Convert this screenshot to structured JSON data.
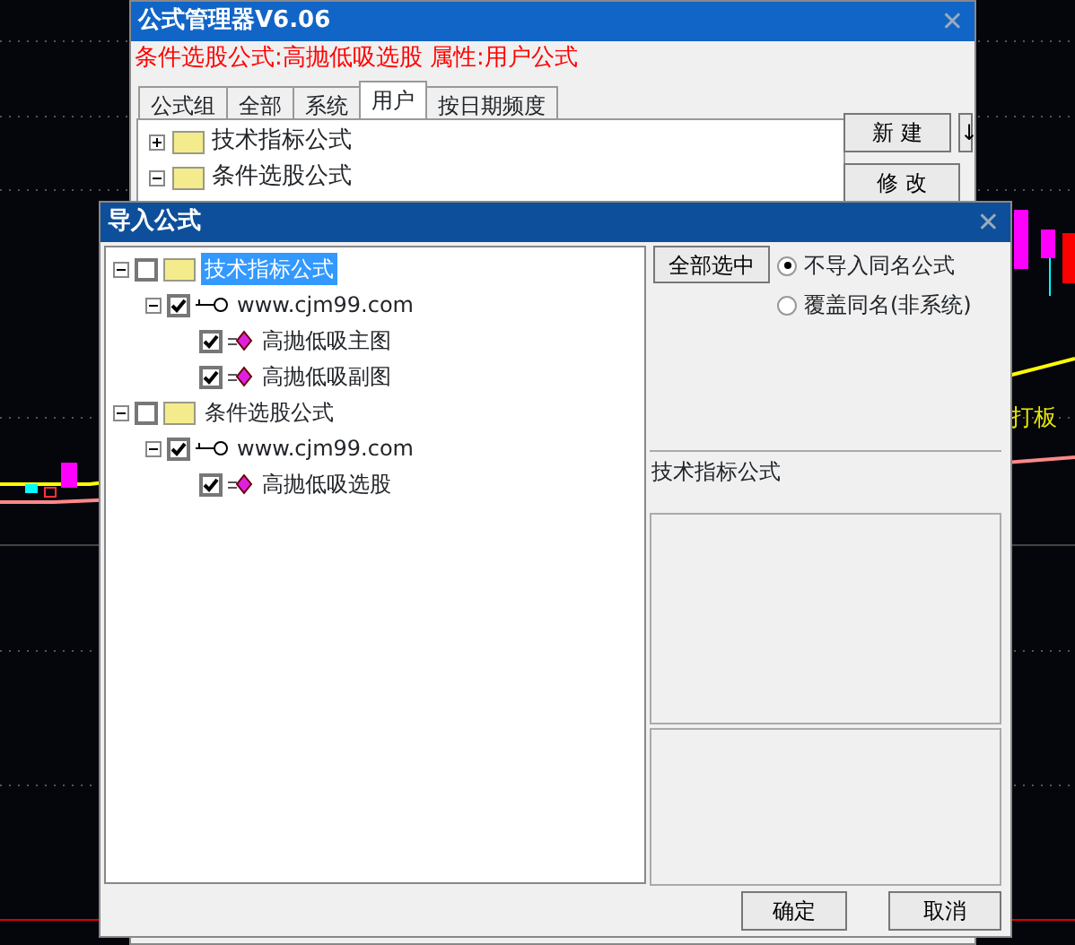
{
  "chart": {
    "label": "打板"
  },
  "manager_window": {
    "title": "公式管理器V6.06",
    "close": "✕",
    "info": "条件选股公式:高抛低吸选股  属性:用户公式",
    "tabs": [
      {
        "label": "公式组",
        "selected": false
      },
      {
        "label": "全部",
        "selected": false
      },
      {
        "label": "系统",
        "selected": false
      },
      {
        "label": "用户",
        "selected": true
      },
      {
        "label": "按日期频度",
        "selected": false
      }
    ],
    "tree": [
      {
        "label": "技术指标公式",
        "expanded": false
      },
      {
        "label": "条件选股公式",
        "expanded": true
      }
    ],
    "buttons": [
      {
        "label": "新  建",
        "arrow": "↓"
      },
      {
        "label": "修  改"
      }
    ]
  },
  "import_dialog": {
    "title": "导入公式",
    "close": "✕",
    "tree": [
      {
        "kind": "folder",
        "label": "技术指标公式",
        "checked": false,
        "expanded": true,
        "selected": true,
        "children": [
          {
            "kind": "site",
            "label": "www.cjm99.com",
            "checked": true,
            "expanded": true,
            "selected": false,
            "children": [
              {
                "kind": "formula",
                "label": "高抛低吸主图",
                "checked": true,
                "selected": false
              },
              {
                "kind": "formula",
                "label": "高抛低吸副图",
                "checked": true,
                "selected": false
              }
            ]
          }
        ]
      },
      {
        "kind": "folder",
        "label": "条件选股公式",
        "checked": false,
        "expanded": true,
        "selected": false,
        "children": [
          {
            "kind": "site",
            "label": "www.cjm99.com",
            "checked": true,
            "expanded": true,
            "selected": false,
            "children": [
              {
                "kind": "formula",
                "label": "高抛低吸选股",
                "checked": true,
                "selected": false
              }
            ]
          }
        ]
      }
    ],
    "select_all": "全部选中",
    "options": [
      {
        "label": "不导入同名公式",
        "selected": true
      },
      {
        "label": "覆盖同名(非系统)",
        "selected": false
      }
    ],
    "description": "技术指标公式",
    "ok": "确定",
    "cancel": "取消"
  }
}
